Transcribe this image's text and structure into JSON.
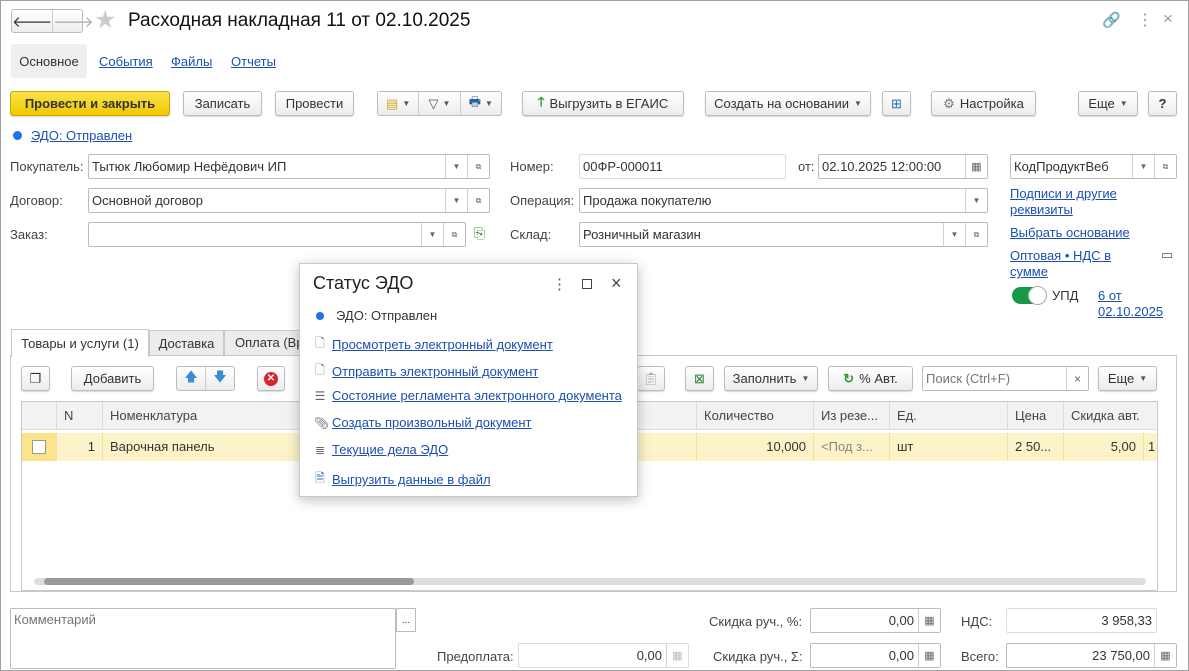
{
  "window": {
    "title": "Расходная накладная 11 от 02.10.2025"
  },
  "nav_tabs": [
    {
      "label": "Основное",
      "active": true
    },
    {
      "label": "События"
    },
    {
      "label": "Файлы"
    },
    {
      "label": "Отчеты"
    }
  ],
  "toolbar": {
    "post_close": "Провести и закрыть",
    "save": "Записать",
    "post": "Провести",
    "egais": "Выгрузить в ЕГАИС",
    "create_based": "Создать на основании",
    "settings": "Настройка",
    "more": "Еще",
    "help": "?"
  },
  "edo_status_link": "ЭДО: Отправлен",
  "fields": {
    "buyer": {
      "label": "Покупатель:",
      "value": "Тытюк Любомир Нефёдович ИП"
    },
    "contract": {
      "label": "Договор:",
      "value": "Основной договор"
    },
    "order": {
      "label": "Заказ:",
      "value": ""
    },
    "number": {
      "label": "Номер:",
      "value": "00ФР-000011"
    },
    "date": {
      "label": "от:",
      "value": "02.10.2025 12:00:00"
    },
    "operation": {
      "label": "Операция:",
      "value": "Продажа покупателю"
    },
    "warehouse": {
      "label": "Склад:",
      "value": "Розничный магазин"
    },
    "org": {
      "value": "КодПродуктВеб"
    }
  },
  "side_links": {
    "signatures_1": "Подписи и другие",
    "signatures_2": "реквизиты",
    "choose_basis": "Выбрать основание",
    "price_1": "Оптовая • НДС в",
    "price_2": "сумме",
    "upd_label": "УПД",
    "upd_on": true,
    "upd_link_1": "6 от",
    "upd_link_2": "02.10.2025"
  },
  "content_tabs": [
    {
      "label": "Товары и услуги (1)",
      "active": true
    },
    {
      "label": "Доставка"
    },
    {
      "label": "Оплата (Вр"
    }
  ],
  "table_toolbar": {
    "add": "Добавить",
    "fill": "Заполнить",
    "auto_pct": "% Авт.",
    "search_placeholder": "Поиск (Ctrl+F)",
    "clear": "×",
    "more": "Еще"
  },
  "table": {
    "columns": [
      "N",
      "Номенклатура",
      "Количество",
      "Из резе...",
      "Ед.",
      "Цена",
      "Скидка авт."
    ],
    "rows": [
      {
        "n": "1",
        "item": "Варочная панель",
        "qty": "10,000",
        "reserve": "<Под з...",
        "unit": "шт",
        "price": "2 50...",
        "discount": "5,00",
        "extra": "1"
      }
    ]
  },
  "footer": {
    "comment_placeholder": "Комментарий",
    "comment_btn": "...",
    "disc_pct_label": "Скидка руч., %:",
    "disc_pct": "0,00",
    "vat_label": "НДС:",
    "vat": "3 958,33",
    "prepay_label": "Предоплата:",
    "prepay": "0,00",
    "disc_sum_label": "Скидка руч., Σ:",
    "disc_sum": "0,00",
    "total_label": "Всего:",
    "total": "23 750,00"
  },
  "popup": {
    "title": "Статус ЭДО",
    "status": "ЭДО: Отправлен",
    "items": [
      {
        "label": "Просмотреть электронный документ",
        "icon": "document-icon"
      },
      {
        "label": "Отправить электронный документ",
        "icon": "send-document-icon"
      },
      {
        "label": "Состояние регламента электронного документа",
        "icon": "regulation-icon"
      },
      {
        "label": "Создать произвольный документ",
        "icon": "paperclip-icon"
      },
      {
        "label": "Текущие дела ЭДО",
        "icon": "tasks-icon"
      },
      {
        "label": "Выгрузить данные в файл",
        "icon": "export-file-icon"
      }
    ]
  },
  "colors": {
    "primary_button": "#f5d20f",
    "link": "#1c4fb0",
    "status_dot": "#1a73e8",
    "toggle_on": "#159947",
    "row_selected": "#fdf3c8"
  }
}
